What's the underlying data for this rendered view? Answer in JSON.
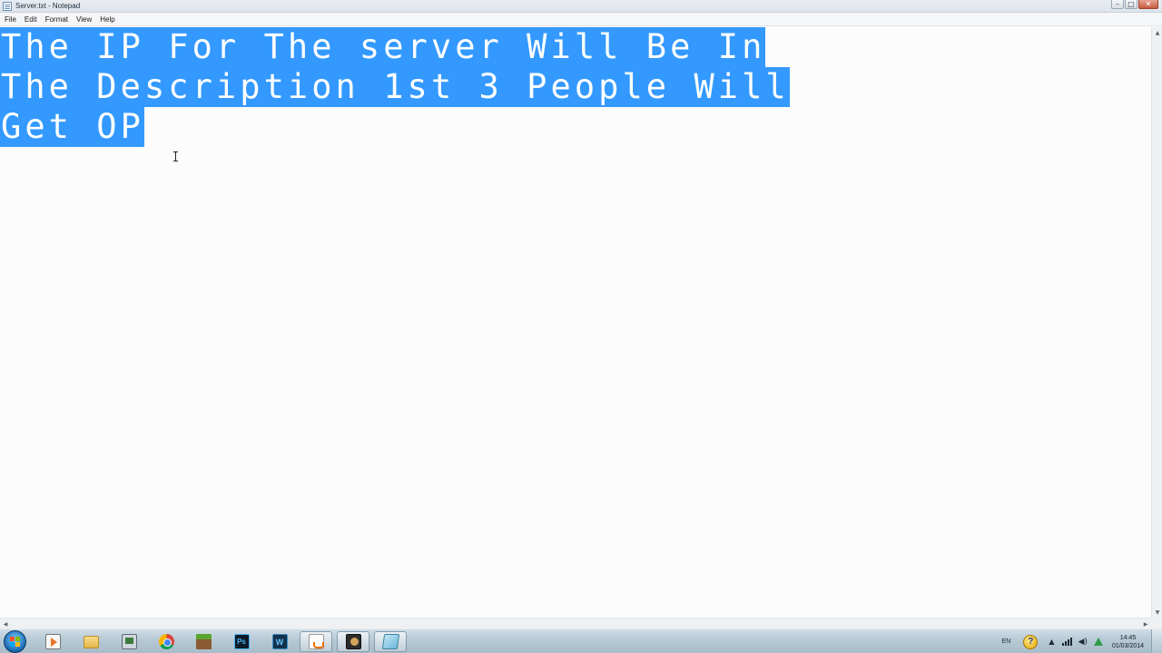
{
  "window": {
    "title": "Server.txt - Notepad",
    "minimize": "–",
    "maximize": "□",
    "close": "✕"
  },
  "menu": [
    "File",
    "Edit",
    "Format",
    "View",
    "Help"
  ],
  "editor": {
    "lines": [
      "The IP For The server Will Be In",
      "The Description 1st 3 People Will",
      "Get OP"
    ],
    "selection_color": "#3399ff",
    "selected_text_color": "#ffffff"
  },
  "taskbar": {
    "icons": [
      {
        "name": "windows-media-player-icon"
      },
      {
        "name": "file-explorer-icon"
      },
      {
        "name": "task-manager-icon"
      },
      {
        "name": "chrome-icon"
      },
      {
        "name": "minecraft-icon"
      },
      {
        "name": "photoshop-icon",
        "glyph": "Ps"
      },
      {
        "name": "app-icon",
        "glyph": "W"
      },
      {
        "name": "java-icon"
      },
      {
        "name": "dark-app-icon"
      },
      {
        "name": "notepad-icon"
      }
    ],
    "tray": {
      "language": "EN",
      "help_glyph": "?",
      "time": "14:45",
      "date": "01/03/2014"
    }
  }
}
